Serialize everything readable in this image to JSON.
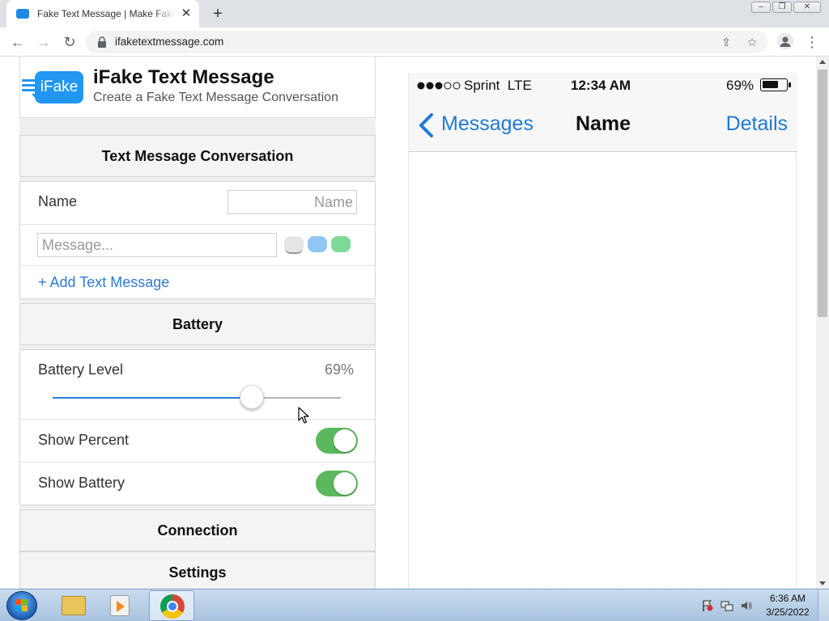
{
  "browser": {
    "tab_title": "Fake Text Message | Make Fake Text Messages",
    "tab_close": "✕",
    "new_tab": "+",
    "url": "ifaketextmessage.com",
    "window_controls": {
      "minimize": "–",
      "maximize": "❐",
      "close": "✕"
    },
    "icons": {
      "back": "←",
      "forward": "→",
      "reload": "↻",
      "share": "⇪",
      "bookmark": "☆",
      "menu": "⋮"
    }
  },
  "brand": {
    "logo_text": "iFake",
    "title": "iFake Text Message",
    "subtitle": "Create a Fake Text Message Conversation"
  },
  "conversation": {
    "header": "Text Message Conversation",
    "name_label": "Name",
    "name_value": "",
    "name_placeholder": "Name",
    "message_value": "",
    "message_placeholder": "Message...",
    "bubble_colors": [
      "#e6e6e6",
      "#8fc7f2",
      "#7fd99a"
    ],
    "add_link": "+ Add Text Message"
  },
  "battery": {
    "header": "Battery",
    "level_label": "Battery Level",
    "level_text": "69%",
    "level_fraction": 0.69,
    "show_percent_label": "Show Percent",
    "show_percent_on": true,
    "show_battery_label": "Show Battery",
    "show_battery_on": true
  },
  "sections": {
    "connection": "Connection",
    "settings": "Settings"
  },
  "phone": {
    "carrier": "Sprint",
    "network": "LTE",
    "time": "12:34 AM",
    "battery_text": "69%",
    "battery_fraction": 0.69,
    "back_label": "Messages",
    "title": "Name",
    "details_label": "Details",
    "accent_color": "#1e7ad6"
  },
  "taskbar": {
    "time": "6:36 AM",
    "date": "3/25/2022",
    "tray_icons": [
      "flag-icon",
      "network-icon",
      "volume-icon"
    ]
  }
}
